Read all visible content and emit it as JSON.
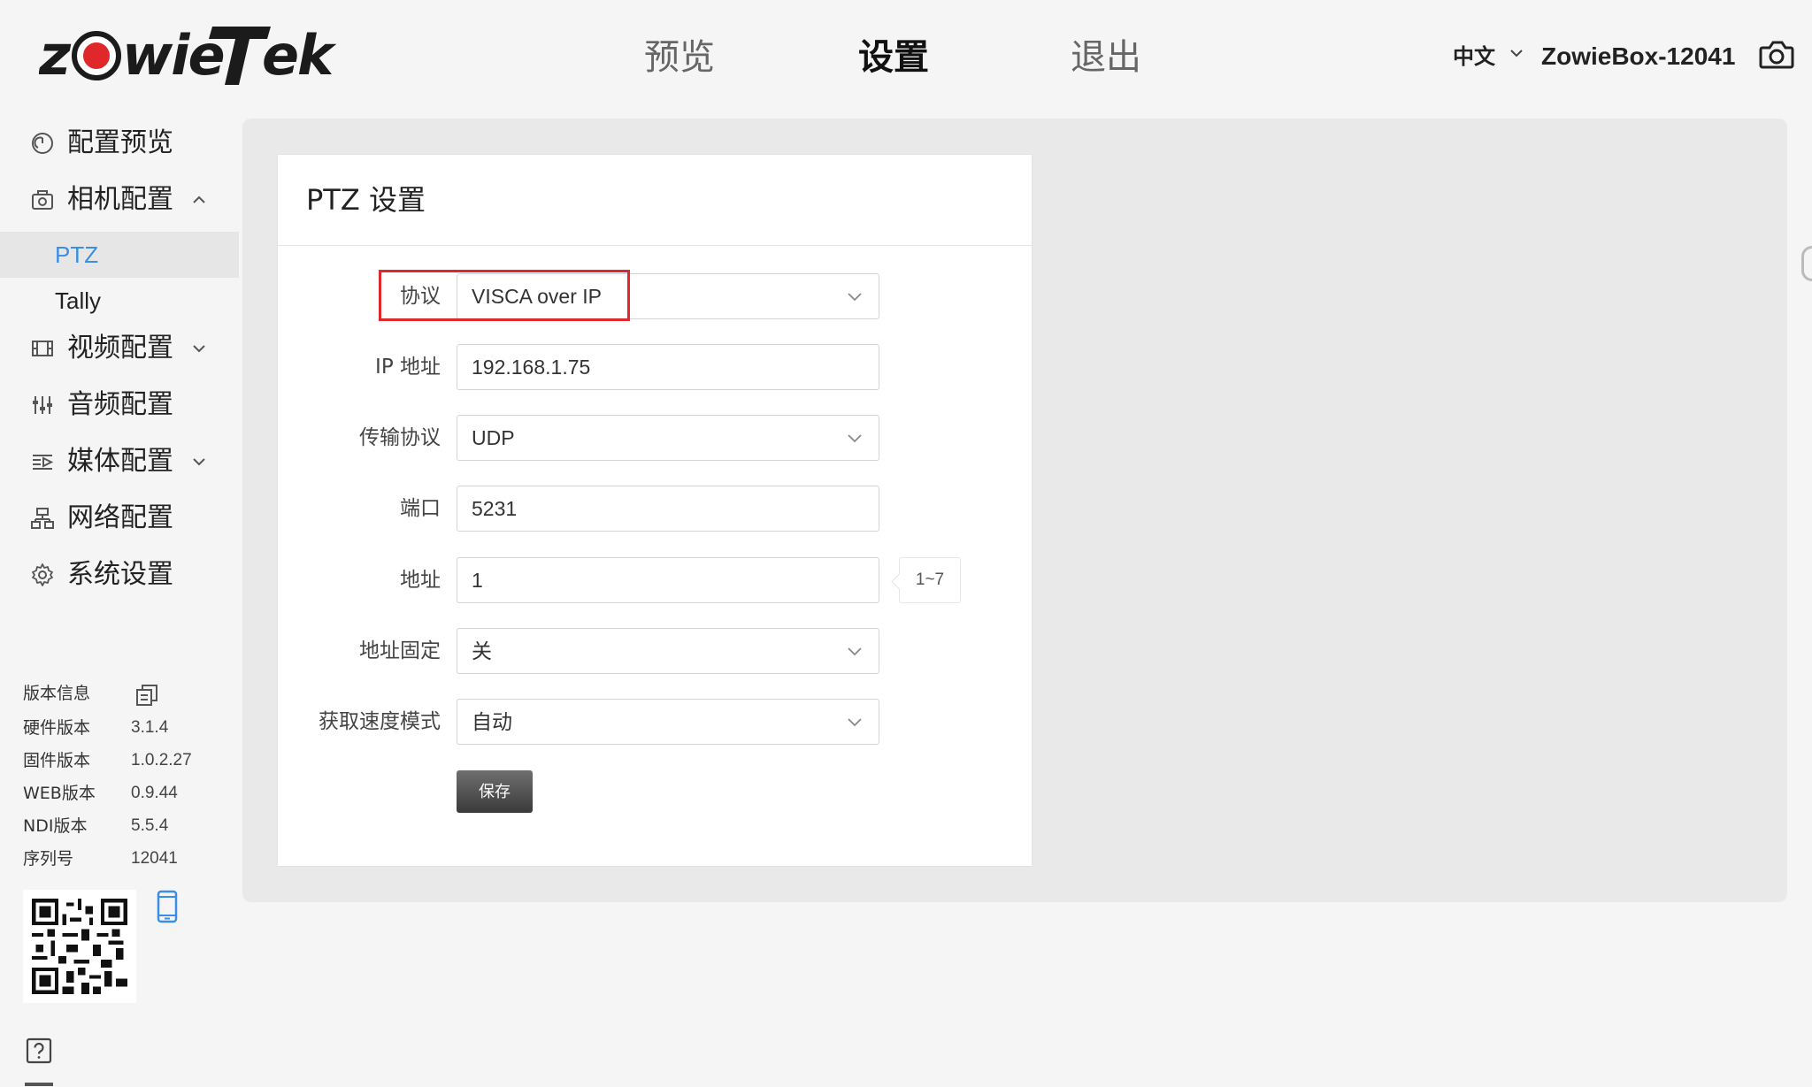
{
  "header": {
    "logo_text": "zowieTek",
    "nav": [
      "预览",
      "设置",
      "退出"
    ],
    "active_nav": "设置",
    "language": "中文",
    "device_name": "ZowieBox-12041"
  },
  "sidebar": {
    "menu": [
      {
        "label": "配置预览",
        "icon": "gauge-icon"
      },
      {
        "label": "相机配置",
        "icon": "camera-icon",
        "expanded": true,
        "children": [
          {
            "label": "PTZ",
            "active": true
          },
          {
            "label": "Tally"
          }
        ]
      },
      {
        "label": "视频配置",
        "icon": "film-icon"
      },
      {
        "label": "音频配置",
        "icon": "sliders-icon"
      },
      {
        "label": "媒体配置",
        "icon": "media-icon"
      },
      {
        "label": "网络配置",
        "icon": "network-icon"
      },
      {
        "label": "系统设置",
        "icon": "gear-icon"
      }
    ],
    "info": [
      {
        "key": "版本信息",
        "value": ""
      },
      {
        "key": "硬件版本",
        "value": "3.1.4"
      },
      {
        "key": "固件版本",
        "value": "1.0.2.27"
      },
      {
        "key": "WEB版本",
        "value": "0.9.44"
      },
      {
        "key": "NDI版本",
        "value": "5.5.4"
      },
      {
        "key": "序列号",
        "value": "12041"
      }
    ]
  },
  "card": {
    "title": "PTZ 设置",
    "fields": [
      {
        "label": "协议",
        "value": "VISCA over IP",
        "type": "select"
      },
      {
        "label": "IP 地址",
        "value": "192.168.1.75",
        "type": "input"
      },
      {
        "label": "传输协议",
        "value": "UDP",
        "type": "select"
      },
      {
        "label": "端口",
        "value": "5231",
        "type": "input"
      },
      {
        "label": "地址",
        "value": "1",
        "type": "input",
        "hint": "1~7"
      },
      {
        "label": "地址固定",
        "value": "关",
        "type": "select"
      },
      {
        "label": "获取速度模式",
        "value": "自动",
        "type": "select"
      }
    ],
    "save_label": "保存"
  },
  "colors": {
    "accent": "#3a8ee6",
    "highlight": "#e0272a",
    "logo_red": "#e0272a"
  }
}
